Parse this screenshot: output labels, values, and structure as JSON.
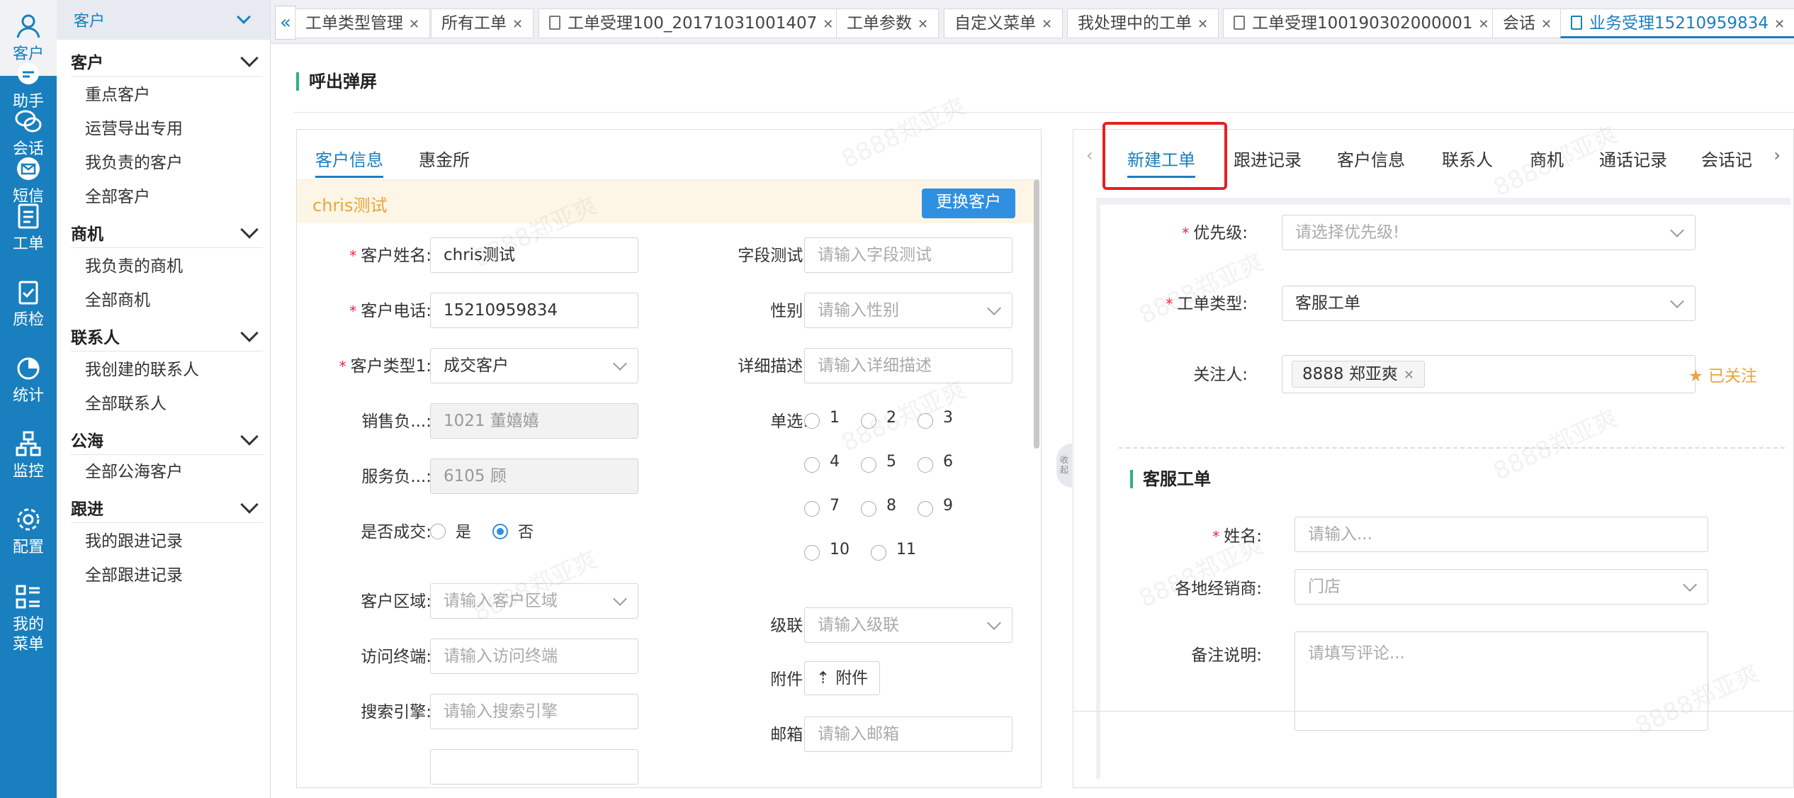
{
  "rail": [
    {
      "label": "客户",
      "icon": "user-icon"
    },
    {
      "label": "助手",
      "icon": "assistant-icon"
    },
    {
      "label": "会话",
      "icon": "chat-icon"
    },
    {
      "label": "短信",
      "icon": "mail-icon"
    },
    {
      "label": "工单",
      "icon": "clipboard-icon"
    },
    {
      "label": "质检",
      "icon": "checklist-icon"
    },
    {
      "label": "统计",
      "icon": "pie-chart-icon"
    },
    {
      "label": "监控",
      "icon": "monitor-icon"
    },
    {
      "label": "配置",
      "icon": "gear-icon"
    },
    {
      "label": "我的菜单",
      "icon": "menu-list-icon"
    }
  ],
  "sidebar": {
    "header": "客户",
    "groups": [
      {
        "label": "客户",
        "items": [
          "重点客户",
          "运营导出专用",
          "我负责的客户",
          "全部客户"
        ]
      },
      {
        "label": "商机",
        "items": [
          "我负责的商机",
          "全部商机"
        ]
      },
      {
        "label": "联系人",
        "items": [
          "我创建的联系人",
          "全部联系人"
        ]
      },
      {
        "label": "公海",
        "items": [
          "全部公海客户"
        ]
      },
      {
        "label": "跟进",
        "items": [
          "我的跟进记录",
          "全部跟进记录"
        ]
      }
    ]
  },
  "tabs": [
    {
      "label": "工单类型管理",
      "doc": false
    },
    {
      "label": "所有工单",
      "doc": false
    },
    {
      "label": "工单受理100_20171031001407",
      "doc": true
    },
    {
      "label": "工单参数",
      "doc": false
    },
    {
      "label": "自定义菜单",
      "doc": false
    },
    {
      "label": "我处理中的工单",
      "doc": false
    },
    {
      "label": "工单受理100190302000001",
      "doc": true
    },
    {
      "label": "会话",
      "doc": false
    },
    {
      "label": "业务受理15210959834",
      "doc": true
    }
  ],
  "page": {
    "title": "呼出弹屏"
  },
  "left": {
    "tabs": [
      "客户信息",
      "惠金所"
    ],
    "customer_name": "chris测试",
    "change_button": "更换客户",
    "fields": {
      "name_label": "客户姓名:",
      "name_value": "chris测试",
      "phone_label": "客户电话:",
      "phone_value": "15210959834",
      "type_label": "客户类型1:",
      "type_value": "成交客户",
      "sales_label": "销售负...:",
      "sales_value": "1021 董嬉嬉",
      "service_label": "服务负...:",
      "service_value": "6105 顾",
      "deal_label": "是否成交:",
      "deal_yes": "是",
      "deal_no": "否",
      "region_label": "客户区域:",
      "region_ph": "请输入客户区域",
      "terminal_label": "访问终端:",
      "terminal_ph": "请输入访问终端",
      "engine_label": "搜索引擎:",
      "engine_ph": "请输入搜索引擎",
      "test_label": "字段测试:",
      "test_ph": "请输入字段测试",
      "gender_label": "性别:",
      "gender_ph": "请输入性别",
      "desc_label": "详细描述:",
      "desc_ph": "请输入详细描述",
      "single_label": "单选:",
      "single_options": [
        "1",
        "2",
        "3",
        "4",
        "5",
        "6",
        "7",
        "8",
        "9",
        "10",
        "11"
      ],
      "cascade_label": "级联:",
      "cascade_ph": "请输入级联",
      "attach_label": "附件:",
      "attach_btn": "附件",
      "email_label": "邮箱:",
      "email_ph": "请输入邮箱"
    }
  },
  "right": {
    "tabs": [
      "新建工单",
      "跟进记录",
      "客户信息",
      "联系人",
      "商机",
      "通话记录",
      "会话记"
    ],
    "priority_label": "优先级:",
    "priority_ph": "请选择优先级!",
    "type_label": "工单类型:",
    "type_value": "客服工单",
    "watcher_label": "关注人:",
    "watcher_tag": "8888 郑亚爽",
    "followed": "已关注",
    "section_title": "客服工单",
    "name_label": "姓名:",
    "name_ph": "请输入...",
    "dealer_label": "各地经销商:",
    "dealer_ph": "门店",
    "remark_label": "备注说明:",
    "remark_ph": "请填写评论..."
  },
  "collapse_handle": "收起",
  "watermark": "8888郑亚爽",
  "colors": {
    "primary": "#1a7fbe",
    "accent_green": "#2fb37a",
    "required": "#e24",
    "highlight": "#e62020"
  }
}
